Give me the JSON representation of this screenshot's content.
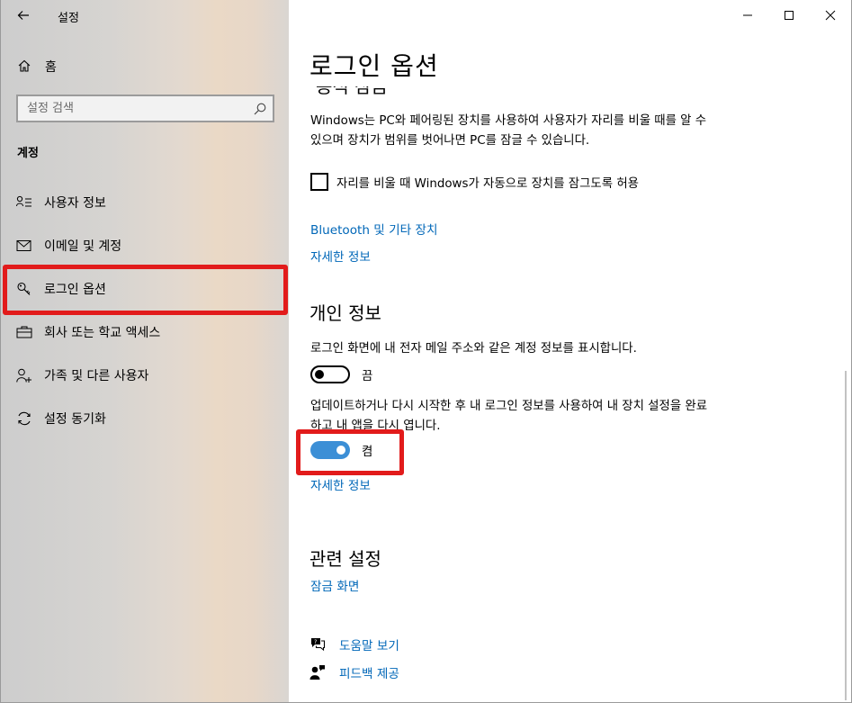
{
  "app": {
    "title": "설정"
  },
  "sidebar": {
    "home_label": "홈",
    "search_placeholder": "설정 검색",
    "section_label": "계정",
    "items": [
      {
        "label": "사용자 정보",
        "icon": "user-info-icon"
      },
      {
        "label": "이메일 및 계정",
        "icon": "mail-icon"
      },
      {
        "label": "로그인 옵션",
        "icon": "key-icon",
        "selected": true
      },
      {
        "label": "회사 또는 학교 액세스",
        "icon": "briefcase-icon"
      },
      {
        "label": "가족 및 다른 사용자",
        "icon": "person-add-icon"
      },
      {
        "label": "설정 동기화",
        "icon": "sync-icon"
      }
    ]
  },
  "main": {
    "title": "로그인 옵션",
    "clipped_heading": "동적 잠금",
    "dynamic_lock_desc": "Windows는 PC와 페어링된 장치를 사용하여 사용자가 자리를 비울 때를 알 수 있으며 장치가 범위를 벗어나면 PC를 잠글 수 있습니다.",
    "dynamic_lock_checkbox": "자리를 비울 때 Windows가 자동으로 장치를 잠그도록 허용",
    "bluetooth_link": "Bluetooth 및 기타 장치",
    "more_info_1": "자세한 정보",
    "privacy_heading": "개인 정보",
    "show_account_details": "로그인 화면에 내 전자 메일 주소와 같은 계정 정보를 표시합니다.",
    "toggle1_state": "끔",
    "use_signin_info": "업데이트하거나 다시 시작한 후 내 로그인 정보를 사용하여 내 장치 설정을 완료하고 내 앱을 다시 엽니다.",
    "toggle2_state": "켬",
    "more_info_2": "자세한 정보",
    "related_heading": "관련 설정",
    "lock_screen_link": "잠금 화면",
    "help_link": "도움말 보기",
    "feedback_link": "피드백 제공"
  },
  "toggles": {
    "show_account_details_on": false,
    "use_signin_info_on": true
  },
  "colors": {
    "link": "#0067b8",
    "toggle_on": "#3c8fd6",
    "annotation": "#e21b1b"
  }
}
